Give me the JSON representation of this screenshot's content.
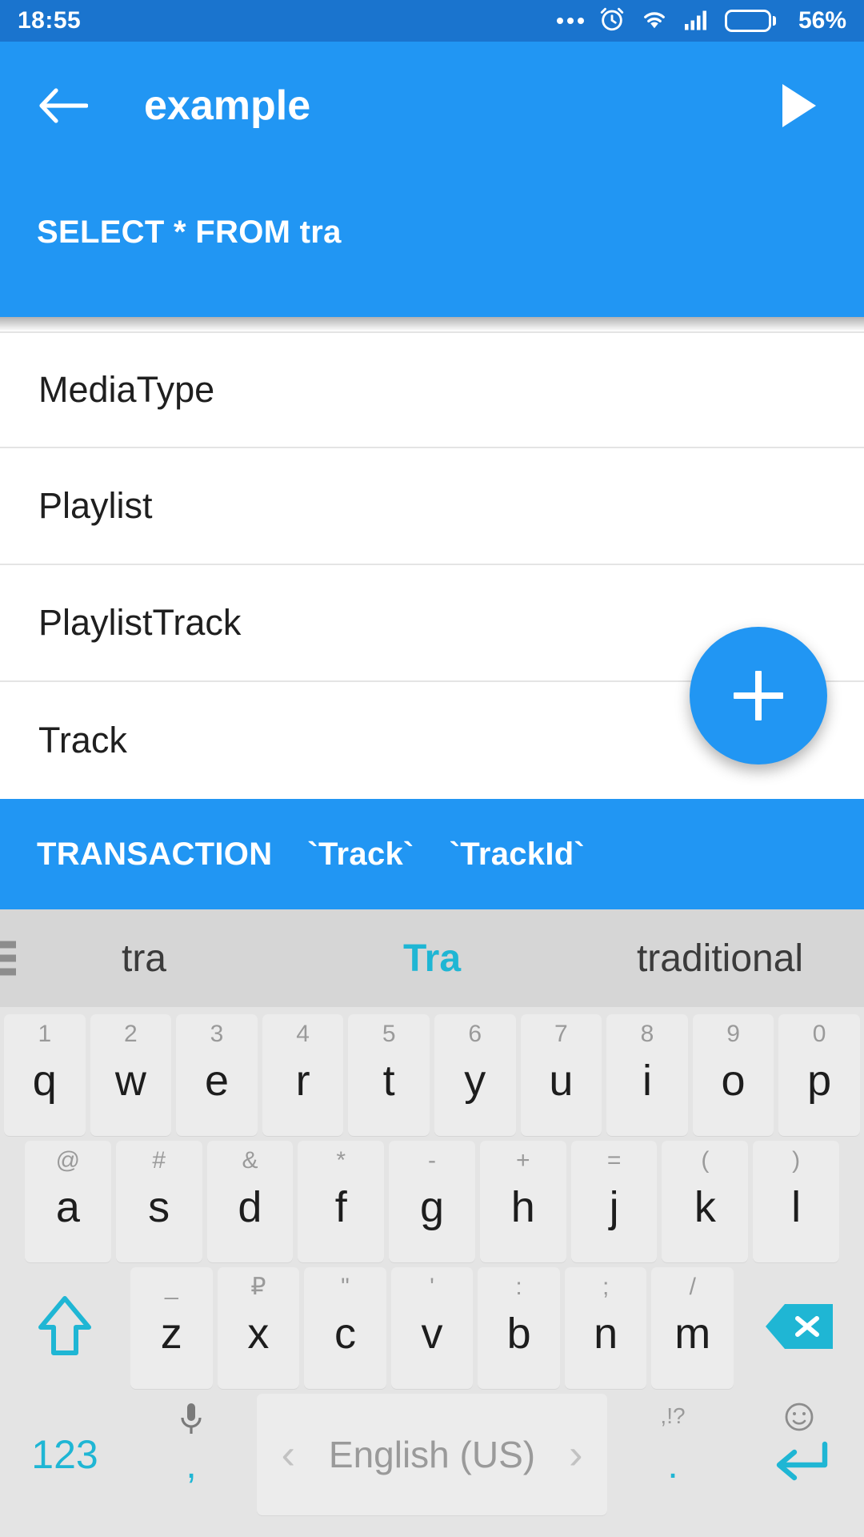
{
  "status_bar": {
    "time": "18:55",
    "battery_percent": "56%",
    "icons": [
      "more-dots-icon",
      "alarm-clock-icon",
      "wifi-icon",
      "cell-signal-icon",
      "battery-icon"
    ]
  },
  "app_bar": {
    "back_icon": "arrow-back-icon",
    "title": "example",
    "run_icon": "play-run-icon",
    "query_text": "SELECT * FROM tra"
  },
  "table_list": {
    "items": [
      {
        "label": "MediaType"
      },
      {
        "label": "Playlist"
      },
      {
        "label": "PlaylistTrack"
      },
      {
        "label": "Track"
      }
    ]
  },
  "fab": {
    "icon": "plus-icon",
    "label": "+"
  },
  "sql_suggestions": {
    "items": [
      "TRANSACTION",
      "`Track`",
      "`TrackId`"
    ]
  },
  "keyboard": {
    "suggestion_bar": {
      "menu_icon": "hamburger-menu-icon",
      "suggestions": [
        {
          "text": "tra",
          "active": false
        },
        {
          "text": "Tra",
          "active": true
        },
        {
          "text": "traditional",
          "active": false
        }
      ]
    },
    "row1": [
      {
        "main": "q",
        "sub": "1"
      },
      {
        "main": "w",
        "sub": "2"
      },
      {
        "main": "e",
        "sub": "3"
      },
      {
        "main": "r",
        "sub": "4"
      },
      {
        "main": "t",
        "sub": "5"
      },
      {
        "main": "y",
        "sub": "6"
      },
      {
        "main": "u",
        "sub": "7"
      },
      {
        "main": "i",
        "sub": "8"
      },
      {
        "main": "o",
        "sub": "9"
      },
      {
        "main": "p",
        "sub": "0"
      }
    ],
    "row2": [
      {
        "main": "a",
        "sub": "@"
      },
      {
        "main": "s",
        "sub": "#"
      },
      {
        "main": "d",
        "sub": "&"
      },
      {
        "main": "f",
        "sub": "*"
      },
      {
        "main": "g",
        "sub": "-"
      },
      {
        "main": "h",
        "sub": "+"
      },
      {
        "main": "j",
        "sub": "="
      },
      {
        "main": "k",
        "sub": "("
      },
      {
        "main": "l",
        "sub": ")"
      }
    ],
    "row3": {
      "shift_icon": "shift-arrow-icon",
      "keys": [
        {
          "main": "z",
          "sub": "_"
        },
        {
          "main": "x",
          "sub": "₽"
        },
        {
          "main": "c",
          "sub": "\""
        },
        {
          "main": "v",
          "sub": "'"
        },
        {
          "main": "b",
          "sub": ":"
        },
        {
          "main": "n",
          "sub": ";"
        },
        {
          "main": "m",
          "sub": "/"
        }
      ],
      "backspace_icon": "backspace-delete-icon"
    },
    "row4": {
      "numbers_label": "123",
      "comma_label": ",",
      "mic_icon": "microphone-icon",
      "space_label": "English (US)",
      "prev_lang_icon": "chevron-left-icon",
      "next_lang_icon": "chevron-right-icon",
      "period_label": ".",
      "punctuation_sub": ",!?",
      "emoji_icon": "smiley-face-icon",
      "enter_icon": "enter-return-icon"
    }
  },
  "colors": {
    "status_bar": "#1a74ce",
    "app_bar": "#2196f3",
    "accent": "#2196f3",
    "keyboard_accent": "#1fb6d4",
    "keyboard_bg": "#e4e4e4",
    "suggestion_bg": "#d6d6d6"
  }
}
